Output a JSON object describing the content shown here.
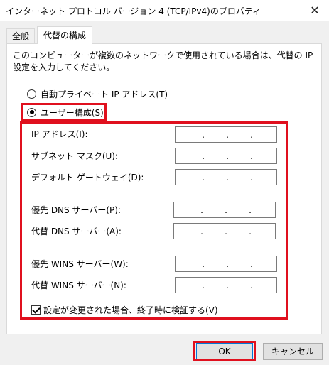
{
  "window": {
    "title": "インターネット プロトコル バージョン 4 (TCP/IPv4)のプロパティ",
    "close_glyph": "✕"
  },
  "tabs": [
    {
      "label": "全般",
      "selected": false
    },
    {
      "label": "代替の構成",
      "selected": true
    }
  ],
  "description": "このコンピューターが複数のネットワークで使用されている場合は、代替の IP 設定を入力してください。",
  "radios": {
    "auto_private": {
      "label": "自動プライベート IP アドレス(T)",
      "checked": false
    },
    "user_config": {
      "label": "ユーザー構成(S)",
      "checked": true
    }
  },
  "fields": {
    "ip_address": {
      "label": "IP アドレス(I):",
      "value": ". . ."
    },
    "subnet_mask": {
      "label": "サブネット マスク(U):",
      "value": ". . ."
    },
    "default_gateway": {
      "label": "デフォルト ゲートウェイ(D):",
      "value": ". . ."
    },
    "preferred_dns": {
      "label": "優先 DNS サーバー(P):",
      "value": ". . ."
    },
    "alternate_dns": {
      "label": "代替 DNS サーバー(A):",
      "value": ". . ."
    },
    "preferred_wins": {
      "label": "優先 WINS サーバー(W):",
      "value": ". . ."
    },
    "alternate_wins": {
      "label": "代替 WINS サーバー(N):",
      "value": ". . ."
    }
  },
  "validate_checkbox": {
    "label": "設定が変更された場合、終了時に検証する(V)",
    "checked": true
  },
  "buttons": {
    "ok": "OK",
    "cancel": "キャンセル"
  },
  "colors": {
    "highlight": "#e0101e",
    "dialog_bg": "#f0f0f0",
    "default_button_border": "#0078d7"
  }
}
